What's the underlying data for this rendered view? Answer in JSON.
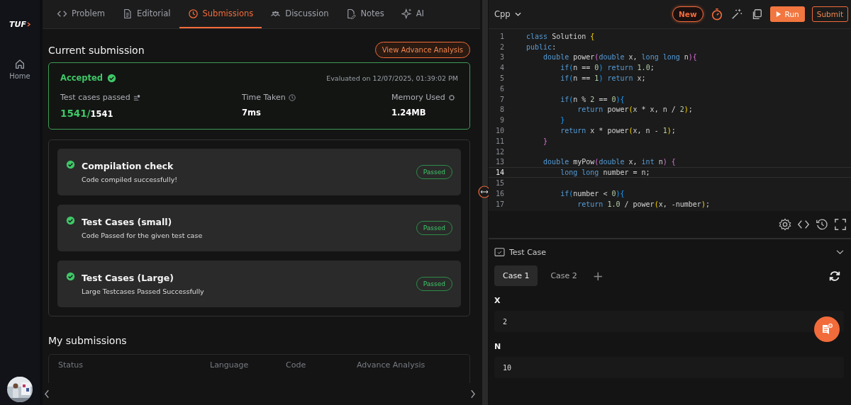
{
  "sidebar": {
    "logo": "TUF",
    "items": [
      {
        "label": "Home"
      }
    ]
  },
  "tabs": [
    {
      "label": "Problem",
      "selected": false
    },
    {
      "label": "Editorial",
      "selected": false
    },
    {
      "label": "Submissions",
      "selected": true
    },
    {
      "label": "Discussion",
      "selected": false
    },
    {
      "label": "Notes",
      "selected": false
    },
    {
      "label": "AI",
      "selected": false
    }
  ],
  "current": {
    "title": "Current submission",
    "analysis_button": "View Advance Analysis",
    "status": "Accepted",
    "evaluated": "Evaluated on 12/07/2025, 01:39:02 PM",
    "stats": [
      {
        "label": "Test cases passed",
        "kind": "fraction",
        "passed": "1541/",
        "total": "1541"
      },
      {
        "label": "Time Taken",
        "kind": "plain",
        "value": "7ms"
      },
      {
        "label": "Memory Used",
        "kind": "plain",
        "value": "1.24MB"
      }
    ]
  },
  "checks": [
    {
      "title": "Compilation check",
      "detail": "Code compiled successfully!",
      "badge": "Passed"
    },
    {
      "title": "Test Cases (small)",
      "detail": "Code Passed for the given test case",
      "badge": "Passed"
    },
    {
      "title": "Test Cases (Large)",
      "detail": "Large Testcases Passed Successfully",
      "badge": "Passed"
    }
  ],
  "my_submissions": {
    "title": "My submissions",
    "columns": [
      "Status",
      "Language",
      "Code",
      "Advance Analysis"
    ]
  },
  "editor": {
    "language": "Cpp",
    "new_button": "New",
    "run_button": "Run",
    "submit_button": "Submit",
    "lines": [
      {
        "number": "1",
        "current": false,
        "tokens": [
          {
            "t": "class",
            "kind": "kw"
          },
          {
            "t": " Solution ",
            "kind": "id"
          },
          {
            "t": "{",
            "kind": "p1"
          }
        ]
      },
      {
        "number": "2",
        "current": false,
        "tokens": [
          {
            "t": "public",
            "kind": "kw"
          },
          {
            "t": ":",
            "kind": "id"
          }
        ]
      },
      {
        "number": "3",
        "current": false,
        "tokens": [
          {
            "t": "    double",
            "kind": "kw"
          },
          {
            "t": " power",
            "kind": "id"
          },
          {
            "t": "(",
            "kind": "p2"
          },
          {
            "t": "double",
            "kind": "kw"
          },
          {
            "t": " x, ",
            "kind": "id"
          },
          {
            "t": "long long",
            "kind": "kw"
          },
          {
            "t": " n",
            "kind": "id"
          },
          {
            "t": "){",
            "kind": "p2"
          }
        ]
      },
      {
        "number": "4",
        "current": false,
        "tokens": [
          {
            "t": "        if",
            "kind": "kw"
          },
          {
            "t": "(",
            "kind": "p3"
          },
          {
            "t": "n == ",
            "kind": "id"
          },
          {
            "t": "0",
            "kind": "num"
          },
          {
            "t": ")",
            "kind": "p3"
          },
          {
            "t": " return",
            "kind": "kw"
          },
          {
            "t": " 1.0",
            "kind": "num"
          },
          {
            "t": ";",
            "kind": "id"
          }
        ]
      },
      {
        "number": "5",
        "current": false,
        "tokens": [
          {
            "t": "        if",
            "kind": "kw"
          },
          {
            "t": "(",
            "kind": "p3"
          },
          {
            "t": "n == ",
            "kind": "id"
          },
          {
            "t": "1",
            "kind": "num"
          },
          {
            "t": ")",
            "kind": "p3"
          },
          {
            "t": " return",
            "kind": "kw"
          },
          {
            "t": " x;",
            "kind": "id"
          }
        ]
      },
      {
        "number": "6",
        "current": false
      },
      {
        "number": "7",
        "current": false,
        "tokens": [
          {
            "t": "        if",
            "kind": "kw"
          },
          {
            "t": "(",
            "kind": "p3"
          },
          {
            "t": "n % ",
            "kind": "id"
          },
          {
            "t": "2",
            "kind": "num"
          },
          {
            "t": " == ",
            "kind": "id"
          },
          {
            "t": "0",
            "kind": "num"
          },
          {
            "t": "){",
            "kind": "p3"
          }
        ]
      },
      {
        "number": "8",
        "current": false,
        "tokens": [
          {
            "t": "            return",
            "kind": "kw"
          },
          {
            "t": " power",
            "kind": "id"
          },
          {
            "t": "(",
            "kind": "p1"
          },
          {
            "t": "x * x, n / ",
            "kind": "id"
          },
          {
            "t": "2",
            "kind": "num"
          },
          {
            "t": ")",
            "kind": "p1"
          },
          {
            "t": ";",
            "kind": "id"
          }
        ]
      },
      {
        "number": "9",
        "current": false,
        "tokens": [
          {
            "t": "        }",
            "kind": "p3"
          }
        ]
      },
      {
        "number": "10",
        "current": false,
        "tokens": [
          {
            "t": "        return",
            "kind": "kw"
          },
          {
            "t": " x * power",
            "kind": "id"
          },
          {
            "t": "(",
            "kind": "p1"
          },
          {
            "t": "x, n - ",
            "kind": "id"
          },
          {
            "t": "1",
            "kind": "num"
          },
          {
            "t": ")",
            "kind": "p1"
          },
          {
            "t": ";",
            "kind": "id"
          }
        ]
      },
      {
        "number": "11",
        "current": false,
        "tokens": [
          {
            "t": "    }",
            "kind": "p2"
          }
        ]
      },
      {
        "number": "12",
        "current": false
      },
      {
        "number": "13",
        "current": false,
        "tokens": [
          {
            "t": "    double",
            "kind": "kw"
          },
          {
            "t": " myPow",
            "kind": "id"
          },
          {
            "t": "(",
            "kind": "p2"
          },
          {
            "t": "double",
            "kind": "kw"
          },
          {
            "t": " x, ",
            "kind": "id"
          },
          {
            "t": "int",
            "kind": "kw"
          },
          {
            "t": " n",
            "kind": "id"
          },
          {
            "t": ") {",
            "kind": "p2"
          }
        ]
      },
      {
        "number": "14",
        "current": true,
        "tokens": [
          {
            "t": "        long long",
            "kind": "kw"
          },
          {
            "t": " number = n;",
            "kind": "id"
          }
        ]
      },
      {
        "number": "15",
        "current": false
      },
      {
        "number": "16",
        "current": false,
        "tokens": [
          {
            "t": "        if",
            "kind": "kw"
          },
          {
            "t": "(",
            "kind": "p3"
          },
          {
            "t": "number < ",
            "kind": "id"
          },
          {
            "t": "0",
            "kind": "num"
          },
          {
            "t": "){",
            "kind": "p3"
          }
        ]
      },
      {
        "number": "17",
        "current": false,
        "tokens": [
          {
            "t": "            return",
            "kind": "kw"
          },
          {
            "t": " 1.0",
            "kind": "num"
          },
          {
            "t": " / power",
            "kind": "id"
          },
          {
            "t": "(",
            "kind": "p1"
          },
          {
            "t": "x, -number",
            "kind": "id"
          },
          {
            "t": ")",
            "kind": "p1"
          },
          {
            "t": ";",
            "kind": "id"
          }
        ]
      }
    ]
  },
  "testcase": {
    "title": "Test Case",
    "cases": [
      {
        "label": "Case 1",
        "selected": true
      },
      {
        "label": "Case 2",
        "selected": false
      }
    ],
    "add": "+",
    "inputs": [
      {
        "name": "X",
        "value": "2"
      },
      {
        "name": "N",
        "value": "10"
      }
    ]
  }
}
